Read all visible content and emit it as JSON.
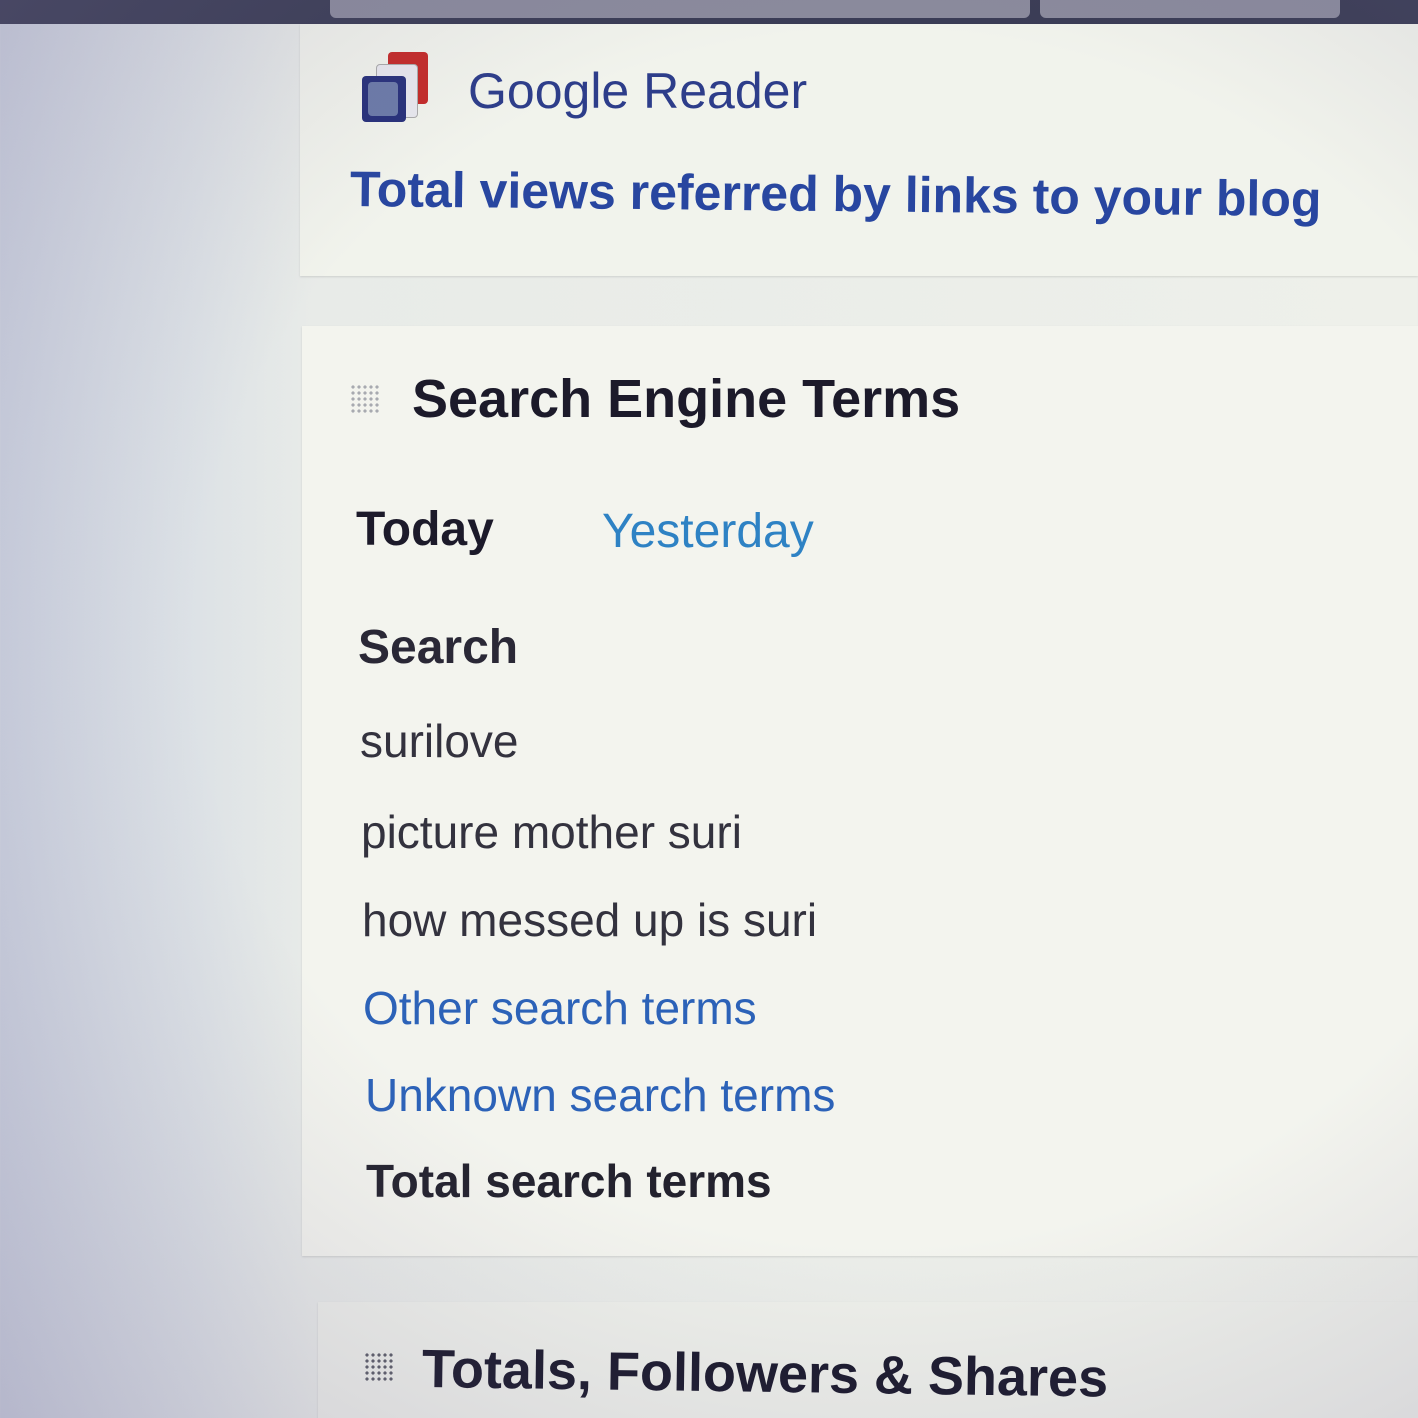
{
  "colors": {
    "link": "#2c62b8",
    "heading": "#1c1a2a",
    "reader_blue": "#2d3d8a",
    "referral_blue": "#2846a0"
  },
  "referrer": {
    "icon": "google-reader-icon",
    "title": "Google Reader",
    "total_label": "Total views referred by links to your blog"
  },
  "search_engine_terms": {
    "title": "Search Engine Terms",
    "handle_icon": "drag-handle-icon",
    "tabs": [
      {
        "label": "Today",
        "active": true
      },
      {
        "label": "Yesterday",
        "active": false
      }
    ],
    "column_header": "Search",
    "terms": [
      "surilove",
      "picture mother suri",
      "how messed up is suri"
    ],
    "other_terms": "Other search terms",
    "unknown_terms": "Unknown search terms",
    "total_terms": "Total search terms"
  },
  "totals_section": {
    "title": "Totals, Followers & Shares",
    "handle_icon": "drag-handle-icon"
  }
}
